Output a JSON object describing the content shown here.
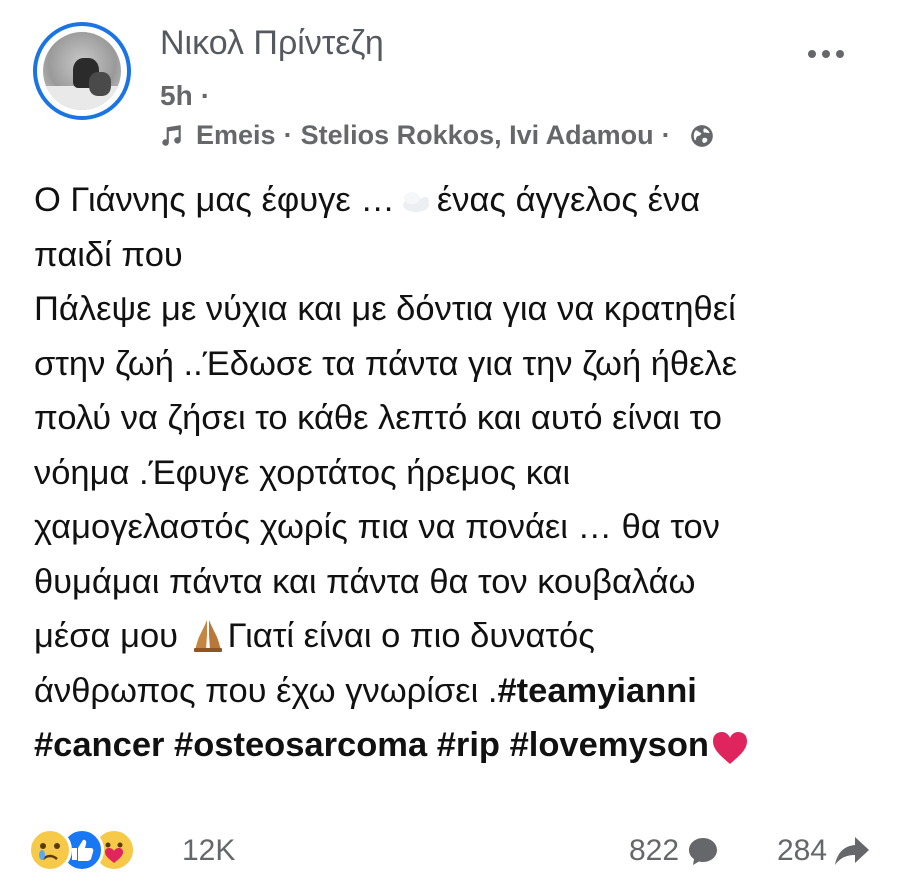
{
  "post": {
    "author": "Νικολ Πρίντεζη",
    "time": "5h",
    "time_sep": "·",
    "music_title": "Emeis",
    "music_sep": "·",
    "music_artists": "Stelios Rokkos, Ivi Adamou",
    "music_sep2": "·",
    "text": {
      "l1a": "Ο Γιάννης μας έφυγε …",
      "l1b": "ένας άγγελος ένα",
      "l2": "παιδί που",
      "l3": "Πάλεψε με νύχια και με δόντια για να κρατηθεί",
      "l4": "στην ζωή ..Έδωσε τα πάντα για την ζωή ήθελε",
      "l5": "πολύ να ζήσει το κάθε λεπτό και αυτό είναι το",
      "l6": "νόημα .Έφυγε χορτάτος ήρεμος και",
      "l7": "χαμογελαστός χωρίς πια να πονάει … θα τον",
      "l8": "θυμάμαι πάντα και πάντα θα τον κουβαλάω",
      "l9a": "μέσα μου",
      "l9b": "Γιατί είναι ο πιο δυνατός",
      "l10a": "άνθρωπος που έχω γνωρίσει .",
      "l10b": "#teamyianni",
      "l11": "#cancer #osteosarcoma #rip #lovemyson"
    }
  },
  "footer": {
    "reactions_count": "12K",
    "comments_count": "822",
    "shares_count": "284"
  },
  "icons": {
    "more": "more-options-icon",
    "note": "music-note-icon",
    "globe": "globe-icon",
    "dove": "dove-emoji",
    "pray": "praying-hands-emoji",
    "heart": "red-heart-emoji",
    "comment": "comment-icon",
    "share": "share-icon"
  },
  "colors": {
    "avatar_ring": "#1b74e4",
    "secondary_text": "#65676b",
    "like_blue": "#1877f2",
    "heart_red": "#e0245e"
  }
}
